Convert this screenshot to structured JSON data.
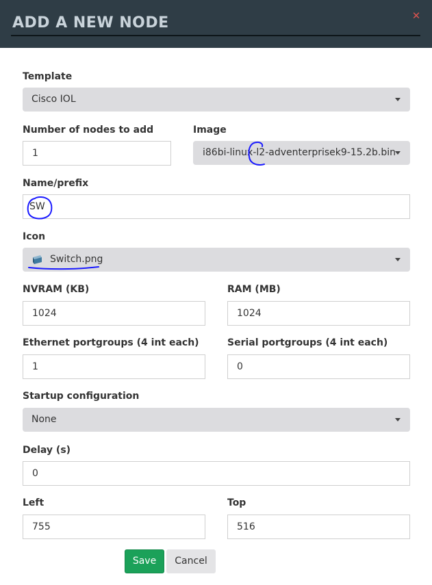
{
  "dialog": {
    "title": "ADD A NEW NODE",
    "close_symbol": "✕"
  },
  "form": {
    "template": {
      "label": "Template",
      "value": "Cisco IOL"
    },
    "number_of_nodes": {
      "label": "Number of nodes to add",
      "value": "1"
    },
    "image": {
      "label": "Image",
      "value": "i86bi-linux-l2-adventerprisek9-15.2b.bin"
    },
    "name_prefix": {
      "label": "Name/prefix",
      "value": "SW"
    },
    "icon": {
      "label": "Icon",
      "value": "Switch.png",
      "icon_name": "switch-icon"
    },
    "nvram": {
      "label": "NVRAM (KB)",
      "value": "1024"
    },
    "ram": {
      "label": "RAM (MB)",
      "value": "1024"
    },
    "ethernet_portgroups": {
      "label": "Ethernet portgroups (4 int each)",
      "value": "1"
    },
    "serial_portgroups": {
      "label": "Serial portgroups (4 int each)",
      "value": "0"
    },
    "startup_config": {
      "label": "Startup configuration",
      "value": "None"
    },
    "delay": {
      "label": "Delay (s)",
      "value": "0"
    },
    "left": {
      "label": "Left",
      "value": "755"
    },
    "top": {
      "label": "Top",
      "value": "516"
    }
  },
  "buttons": {
    "save": "Save",
    "cancel": "Cancel"
  },
  "colors": {
    "header_bg": "#2f3d46",
    "header_text": "#c9d3da",
    "close": "#d9534f",
    "save_bg": "#1ba159",
    "annotation": "#1a1aff"
  }
}
